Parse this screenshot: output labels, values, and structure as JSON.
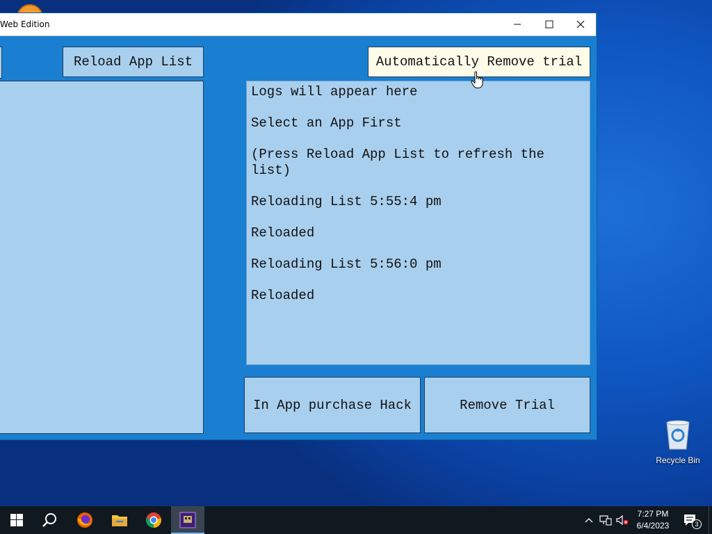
{
  "window": {
    "title": "Web Edition",
    "buttons": {
      "reload": "Reload App List",
      "auto_remove": "Automatically Remove trial",
      "iap_hack": "In App purchase Hack",
      "remove_trial": "Remove Trial"
    },
    "logs": [
      "Logs will appear here",
      "Select an App First",
      "(Press Reload App List to refresh the list)",
      "Reloading List 5:55:4 pm",
      "Reloaded",
      "Reloading List 5:56:0 pm",
      "Reloaded"
    ]
  },
  "desktop": {
    "recycle_bin_label": "Recycle Bin"
  },
  "taskbar": {
    "time": "7:27 PM",
    "date": "6/4/2023",
    "notification_count": "3",
    "apps": [
      "start-icon",
      "search-icon",
      "firefox-icon",
      "file-explorer-icon",
      "chrome-icon",
      "app-icon"
    ]
  },
  "colors": {
    "window_bg": "#1a7fd0",
    "panel_bg": "#a9cfee",
    "highlight_btn": "#fffbe9",
    "taskbar": "#101820"
  }
}
